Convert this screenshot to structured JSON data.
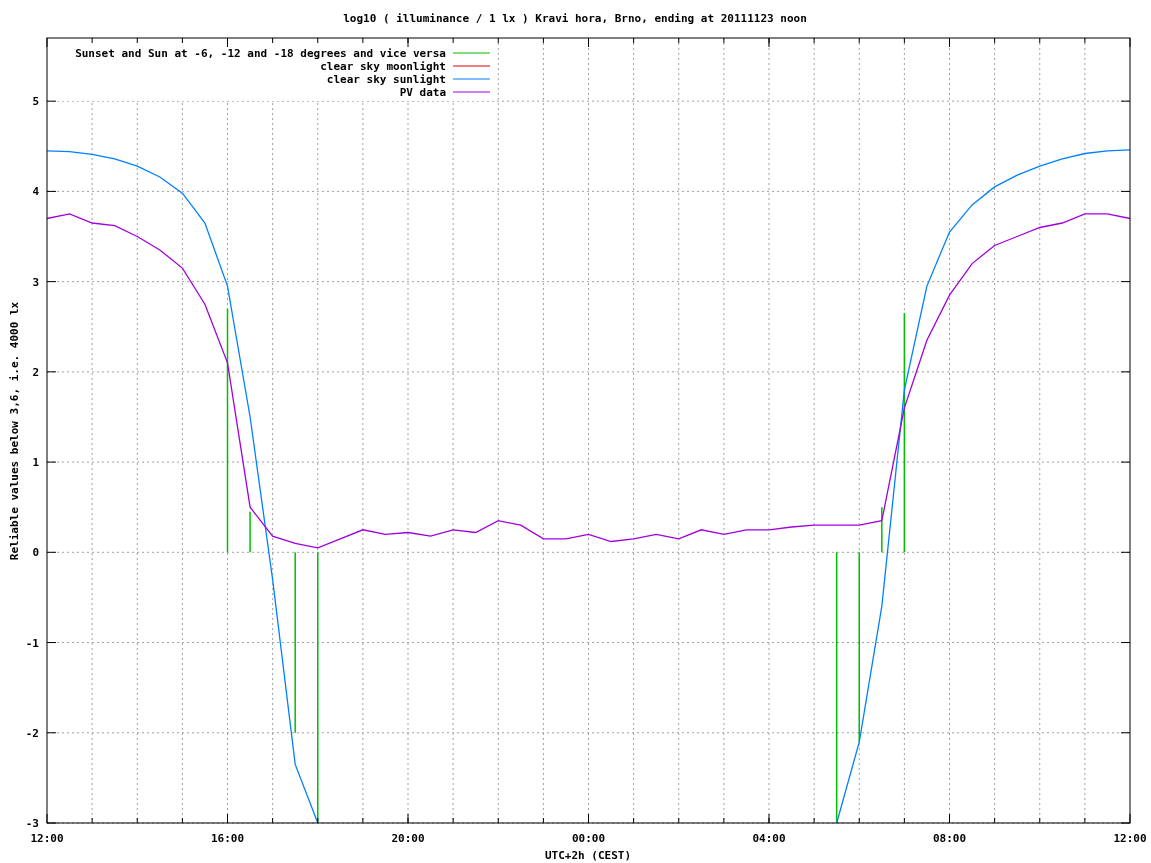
{
  "plot": {
    "chart_data": {
      "type": "line",
      "title": "log10 ( illuminance / 1 lx ) Kravi hora, Brno, ending at 20111123 noon",
      "xlabel": "UTC+2h (CEST)",
      "ylabel": "Reliable values below 3,6, i.e. 4000 lx",
      "categories": [
        "12:00",
        null,
        null,
        null,
        null,
        null,
        null,
        null,
        "16:00",
        null,
        null,
        null,
        null,
        null,
        null,
        null,
        "20:00",
        null,
        null,
        null,
        null,
        null,
        null,
        null,
        "00:00",
        null,
        null,
        null,
        null,
        null,
        null,
        null,
        "04:00",
        null,
        null,
        null,
        null,
        null,
        null,
        null,
        "08:00",
        null,
        null,
        null,
        null,
        null,
        null,
        null,
        "12:00"
      ],
      "ylim": [
        -3,
        5.7
      ],
      "grid": true,
      "legend": "upper left",
      "yticks": [
        -3,
        -2,
        -1,
        0,
        1,
        2,
        3,
        4,
        5
      ],
      "series": [
        {
          "name": "Sunset and Sun at -6, -12 and -18 degrees and vice versa",
          "color": "#00c000",
          "type": "bar",
          "values": [
            null,
            null,
            null,
            null,
            null,
            null,
            null,
            null,
            2.7,
            0.45,
            null,
            -2.0,
            -3.0,
            null,
            null,
            null,
            null,
            null,
            null,
            null,
            null,
            null,
            null,
            null,
            null,
            null,
            null,
            null,
            null,
            null,
            null,
            null,
            null,
            null,
            null,
            -3.0,
            -2.1,
            0.5,
            2.65,
            null,
            null,
            null,
            null,
            null,
            null,
            null,
            null,
            null,
            null
          ]
        },
        {
          "name": "clear sky moonlight",
          "color": "#e00000",
          "values": [
            null,
            null,
            null,
            null,
            null,
            null,
            null,
            null,
            null,
            null,
            null,
            null,
            null,
            null,
            null,
            null,
            null,
            null,
            null,
            null,
            null,
            null,
            null,
            null,
            null,
            null,
            null,
            null,
            null,
            null,
            null,
            null,
            null,
            null,
            null,
            null,
            null,
            null,
            null,
            null,
            null,
            null,
            null,
            null,
            null,
            null,
            null,
            null,
            null
          ]
        },
        {
          "name": "clear sky sunlight",
          "color": "#0080ff",
          "values": [
            4.45,
            4.44,
            4.41,
            4.36,
            4.28,
            4.16,
            3.98,
            3.65,
            2.95,
            1.5,
            -0.3,
            -2.35,
            -3.0,
            null,
            null,
            null,
            null,
            null,
            null,
            null,
            null,
            null,
            null,
            null,
            null,
            null,
            null,
            null,
            null,
            null,
            null,
            null,
            null,
            null,
            null,
            -3.0,
            -2.1,
            -0.6,
            1.8,
            2.95,
            3.55,
            3.85,
            4.05,
            4.18,
            4.28,
            4.36,
            4.42,
            4.45,
            4.46
          ]
        },
        {
          "name": "PV data",
          "color": "#a000e0",
          "values": [
            3.7,
            3.75,
            3.65,
            3.62,
            3.5,
            3.35,
            3.15,
            2.75,
            2.1,
            0.5,
            0.18,
            0.1,
            0.05,
            0.15,
            0.25,
            0.2,
            0.22,
            0.18,
            0.25,
            0.22,
            0.35,
            0.3,
            0.15,
            0.15,
            0.2,
            0.12,
            0.15,
            0.2,
            0.15,
            0.25,
            0.2,
            0.25,
            0.25,
            0.28,
            0.3,
            0.3,
            0.3,
            0.35,
            1.6,
            2.35,
            2.85,
            3.2,
            3.4,
            3.5,
            3.6,
            3.65,
            3.75,
            3.75,
            3.7
          ]
        }
      ]
    }
  }
}
